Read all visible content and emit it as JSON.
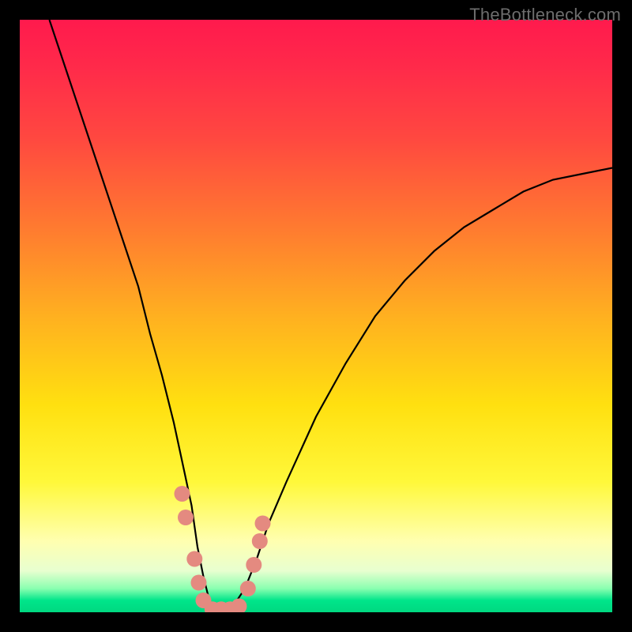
{
  "watermark": "TheBottleneck.com",
  "chart_data": {
    "type": "line",
    "title": "",
    "xlabel": "",
    "ylabel": "",
    "xlim": [
      0,
      100
    ],
    "ylim": [
      0,
      100
    ],
    "grid": false,
    "legend": false,
    "background_gradient": {
      "stops": [
        {
          "pct": 0,
          "color": "#ff1a4d"
        },
        {
          "pct": 8,
          "color": "#ff2a4a"
        },
        {
          "pct": 20,
          "color": "#ff4840"
        },
        {
          "pct": 35,
          "color": "#ff7a30"
        },
        {
          "pct": 50,
          "color": "#ffb020"
        },
        {
          "pct": 65,
          "color": "#ffe010"
        },
        {
          "pct": 78,
          "color": "#fff83a"
        },
        {
          "pct": 88,
          "color": "#ffffb0"
        },
        {
          "pct": 93,
          "color": "#e8ffd0"
        },
        {
          "pct": 96,
          "color": "#8affb0"
        },
        {
          "pct": 98,
          "color": "#00e58a"
        },
        {
          "pct": 100,
          "color": "#00d880"
        }
      ]
    },
    "series": [
      {
        "name": "bottleneck-curve",
        "x": [
          5,
          8,
          11,
          14,
          17,
          20,
          22,
          24,
          26,
          27.5,
          29,
          30,
          31,
          32,
          33,
          34,
          35,
          36,
          38,
          40,
          42,
          45,
          50,
          55,
          60,
          65,
          70,
          75,
          80,
          85,
          90,
          95,
          100
        ],
        "y": [
          100,
          91,
          82,
          73,
          64,
          55,
          47,
          40,
          32,
          25,
          18,
          11,
          6,
          2,
          0,
          0,
          0,
          1,
          4,
          9,
          15,
          22,
          33,
          42,
          50,
          56,
          61,
          65,
          68,
          71,
          73,
          74,
          75
        ]
      }
    ],
    "scatter_points": {
      "name": "highlighted-points",
      "color": "#e48a80",
      "points": [
        {
          "x": 27.4,
          "y": 20
        },
        {
          "x": 28.0,
          "y": 16
        },
        {
          "x": 29.5,
          "y": 9
        },
        {
          "x": 30.2,
          "y": 5
        },
        {
          "x": 31.0,
          "y": 2
        },
        {
          "x": 32.5,
          "y": 0.5
        },
        {
          "x": 34.0,
          "y": 0.5
        },
        {
          "x": 35.5,
          "y": 0.5
        },
        {
          "x": 37.0,
          "y": 1
        },
        {
          "x": 38.5,
          "y": 4
        },
        {
          "x": 39.5,
          "y": 8
        },
        {
          "x": 40.5,
          "y": 12
        },
        {
          "x": 41.0,
          "y": 15
        }
      ]
    }
  }
}
